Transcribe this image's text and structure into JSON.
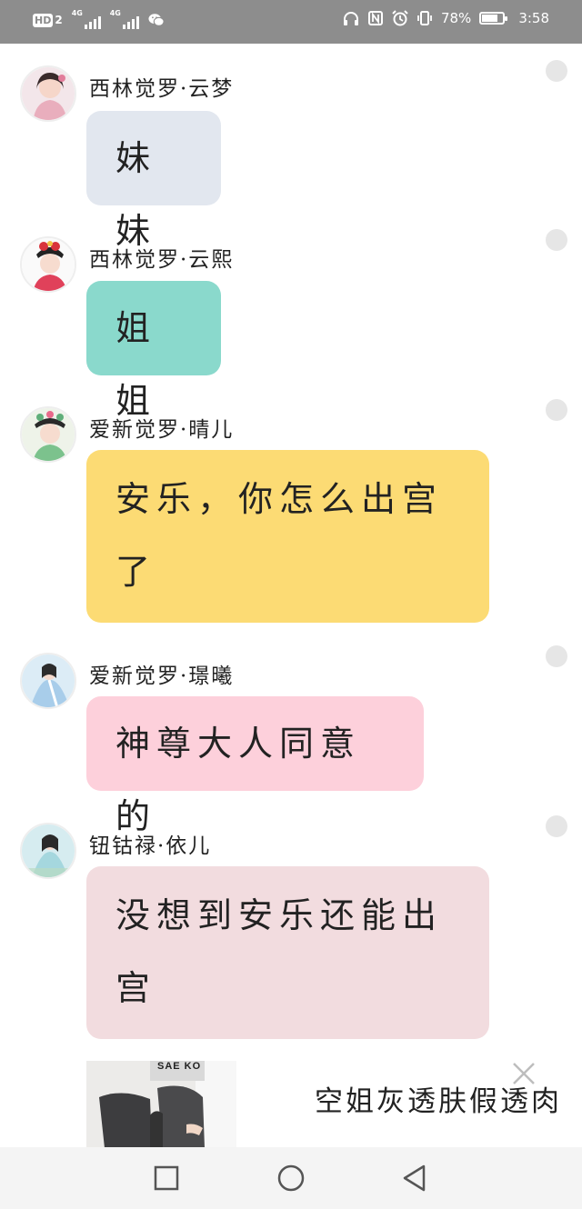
{
  "status_bar": {
    "hd_label": "HD",
    "sim_number": "2",
    "network_1": "4G",
    "network_2": "4G",
    "battery_percent": "78%",
    "battery_level": 0.78,
    "time": "3:58",
    "icons": [
      "wechat-icon",
      "headphones-icon",
      "nfc-icon",
      "alarm-icon",
      "vibrate-icon"
    ]
  },
  "messages": [
    {
      "name": "西林觉罗·云梦",
      "text": "妹妹",
      "color": "#e2e7ef",
      "avatar_theme": "pink-girl"
    },
    {
      "name": "西林觉罗·云熙",
      "text": "姐姐",
      "color": "#8ad9cc",
      "avatar_theme": "red-headdress"
    },
    {
      "name": "爱新觉罗·晴儿",
      "text_line1": "安乐，你怎么出宫",
      "text_line2": "了",
      "color": "#fcdb74",
      "avatar_theme": "green-headdress"
    },
    {
      "name": "爱新觉罗·璟曦",
      "text": "神尊大人同意的",
      "color": "#fdd0db",
      "avatar_theme": "blue-dress"
    },
    {
      "name": "钮钴禄·依儿",
      "text_line1": "没想到安乐还能出",
      "text_line2": "宫",
      "color": "#f2dcdf",
      "avatar_theme": "teal-dress"
    }
  ],
  "ad": {
    "title": "空姐灰透肤假透肉",
    "image": "black-stockings-photo",
    "thumb_text": "SAE KO"
  },
  "nav": {
    "recent": "square-icon",
    "home": "circle-icon",
    "back": "triangle-back-icon"
  }
}
